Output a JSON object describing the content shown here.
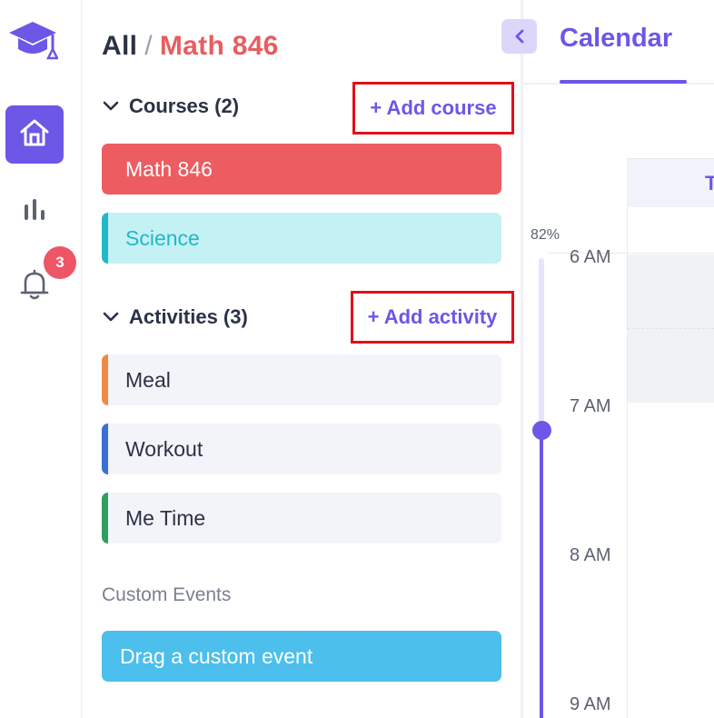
{
  "breadcrumb": {
    "root": "All",
    "separator": "/",
    "current": "Math 846"
  },
  "notifications": {
    "count": "3"
  },
  "courses": {
    "heading": "Courses (2)",
    "add_label": "+ Add course",
    "items": [
      {
        "label": "Math 846",
        "color": "#ed5c61"
      },
      {
        "label": "Science",
        "color": "#c4f1f4"
      }
    ]
  },
  "activities": {
    "heading": "Activities (3)",
    "add_label": "+ Add activity",
    "items": [
      {
        "label": "Meal",
        "accent": "#ee8a45"
      },
      {
        "label": "Workout",
        "accent": "#3a6fd8"
      },
      {
        "label": "Me Time",
        "accent": "#2f9e5e"
      }
    ]
  },
  "custom_events": {
    "heading": "Custom Events",
    "drag_label": "Drag a custom event"
  },
  "calendar": {
    "title": "Calendar",
    "day_header": "T",
    "progress_label": "82%",
    "progress_value": 0.82,
    "times": [
      "6 AM",
      "7 AM",
      "8 AM",
      "9 AM"
    ]
  },
  "colors": {
    "accent": "#6c57e6",
    "highlight_box": "#e0101a",
    "badge": "#ee5566"
  },
  "icons": {
    "logo": "graduation-cap-icon",
    "home": "home-icon",
    "stats": "bar-chart-icon",
    "notifications": "bell-icon",
    "collapse": "chevron-left-icon",
    "section_toggle": "chevron-down-icon"
  }
}
